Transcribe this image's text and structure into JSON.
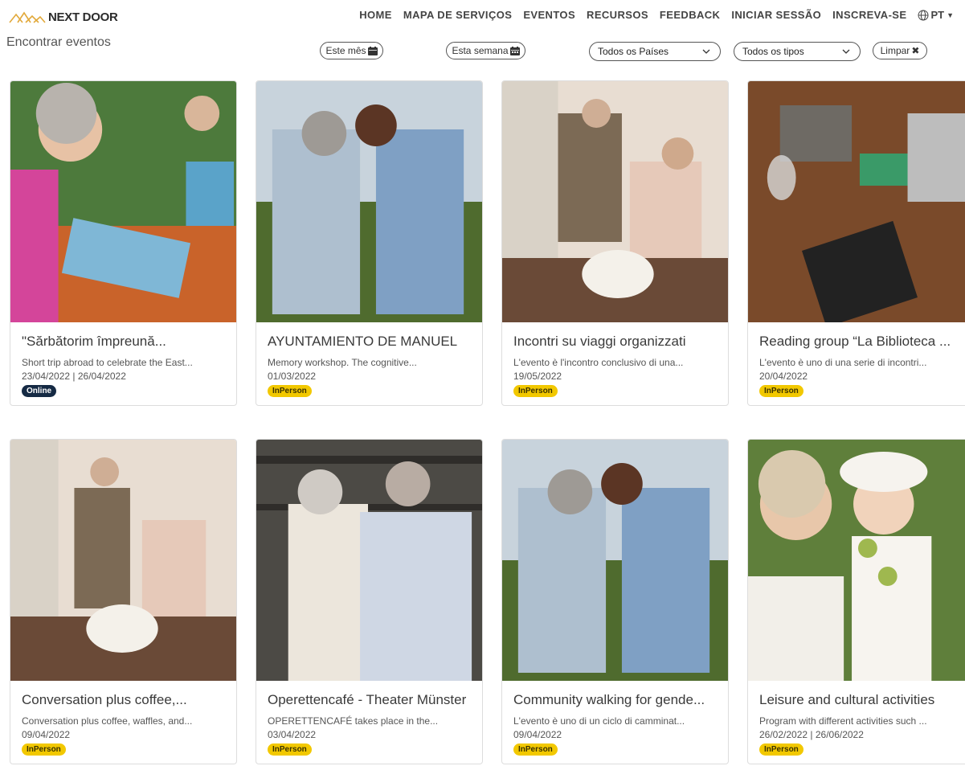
{
  "header": {
    "logo_text": "NEXT DOOR",
    "nav": [
      "HOME",
      "MAPA DE SERVIÇOS",
      "EVENTOS",
      "RECURSOS",
      "FEEDBACK",
      "INICIAR SESSÃO",
      "INSCREVA-SE"
    ],
    "language": "PT"
  },
  "page": {
    "title": "Encontrar eventos"
  },
  "filters": {
    "this_month": "Este mês",
    "this_week": "Esta semana",
    "country": "Todos os Países",
    "type": "Todos os tipos",
    "clear": "Limpar"
  },
  "colors": {
    "inperson_badge": "#f2c800",
    "online_badge": "#152a44"
  },
  "events": [
    {
      "title": "\"Sărbătorim împreună...",
      "desc": "Short trip abroad to celebrate the East...",
      "date": "23/04/2022 | 26/04/2022",
      "type": "Online"
    },
    {
      "title": "AYUNTAMIENTO DE MANUEL",
      "desc": "Memory workshop. The cognitive...",
      "date": "01/03/2022",
      "type": "InPerson"
    },
    {
      "title": "Incontri su viaggi organizzati",
      "desc": "L'evento è l'incontro conclusivo di una...",
      "date": "19/05/2022",
      "type": "InPerson"
    },
    {
      "title": "Reading group “La Biblioteca ...",
      "desc": "L'evento è uno di una serie di incontri...",
      "date": "20/04/2022",
      "type": "InPerson"
    },
    {
      "title": "Conversation plus coffee,...",
      "desc": "Conversation plus coffee, waffles, and...",
      "date": "09/04/2022",
      "type": "InPerson"
    },
    {
      "title": "Operettencafé - Theater Münster",
      "desc": "OPERETTENCAFÉ takes place in the...",
      "date": "03/04/2022",
      "type": "InPerson"
    },
    {
      "title": "Community walking for gende...",
      "desc": "L'evento è uno di un ciclo di camminat...",
      "date": "09/04/2022",
      "type": "InPerson"
    },
    {
      "title": "Leisure and cultural activities",
      "desc": "Program with different activities such ...",
      "date": "26/02/2022 | 26/06/2022",
      "type": "InPerson"
    }
  ]
}
